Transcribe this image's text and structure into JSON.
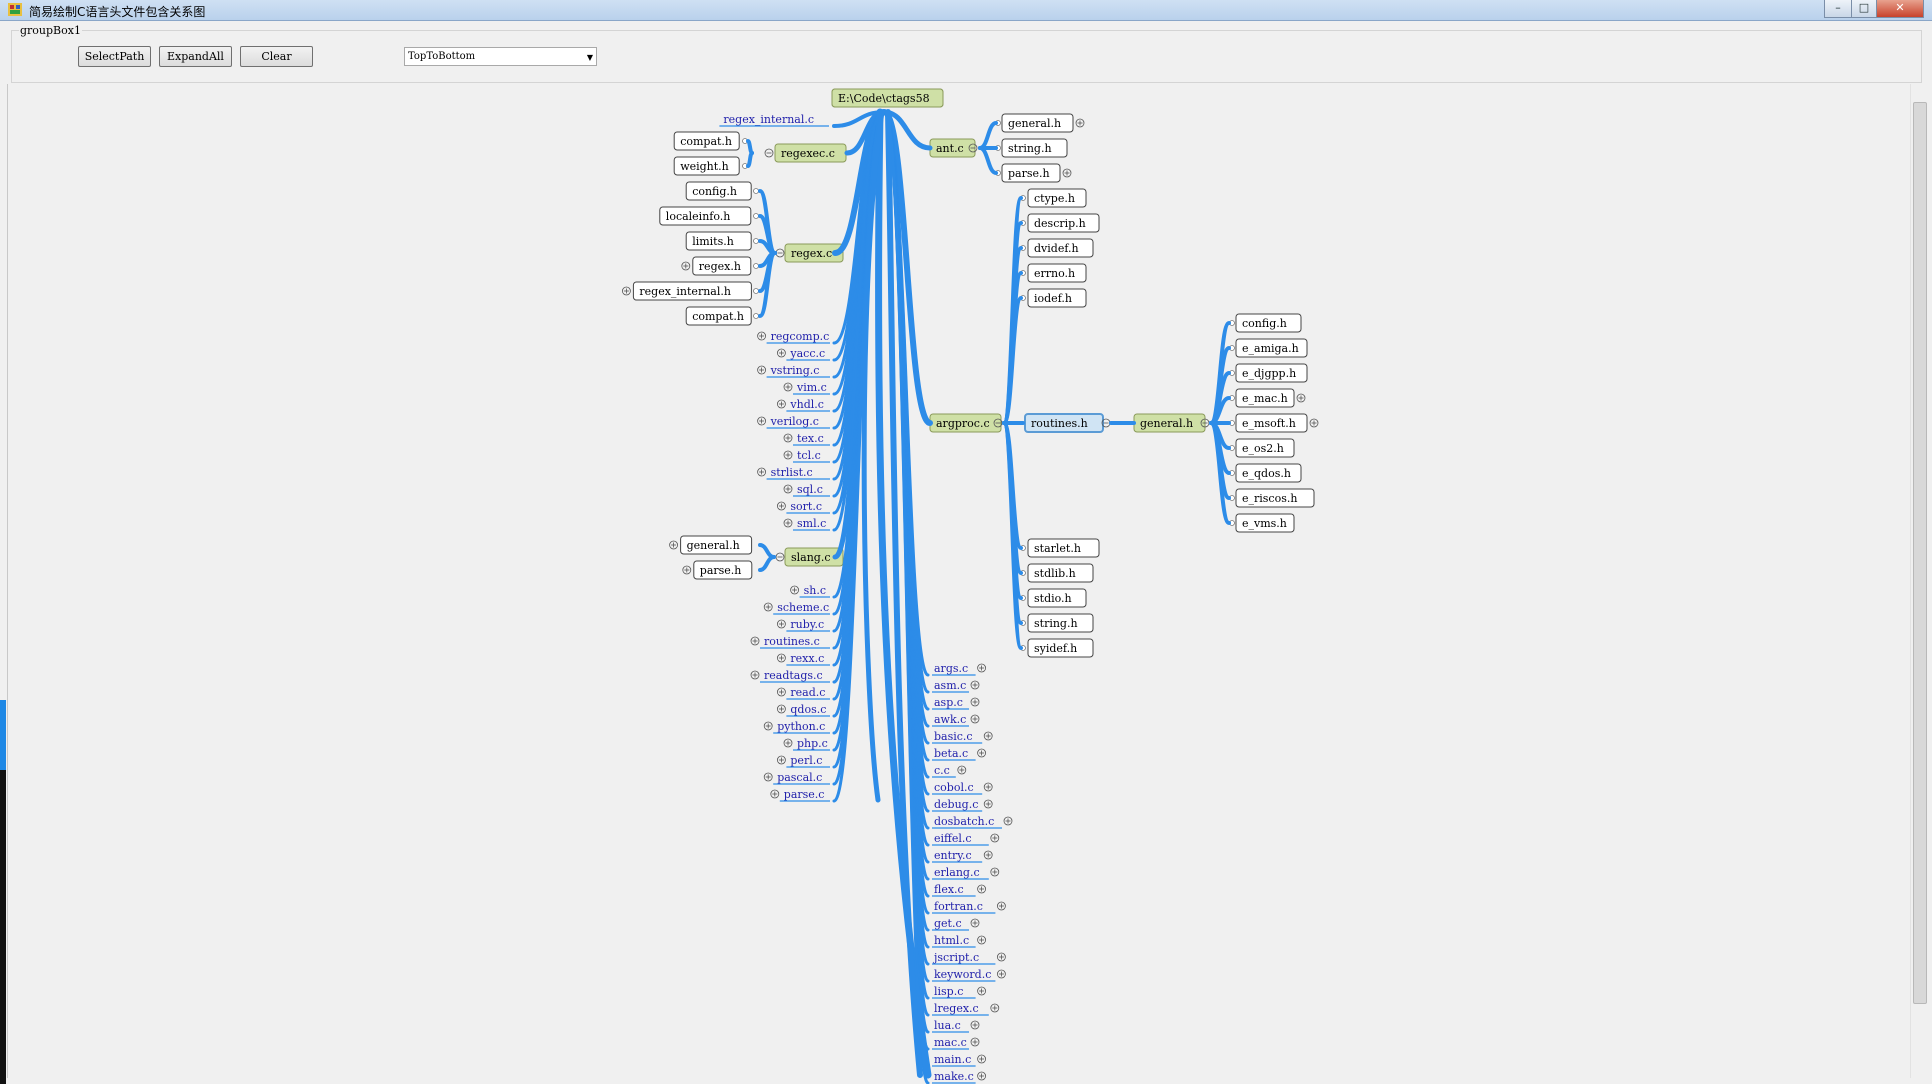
{
  "window": {
    "title": "简易绘制C语言头文件包含关系图",
    "buttons": [
      "–",
      "□",
      "✕"
    ]
  },
  "groupbox": {
    "caption": "groupBox1"
  },
  "toolbar": {
    "select_path": "SelectPath",
    "expand_all": "ExpandAll",
    "clear": "Clear",
    "layout": "TopToBottom"
  },
  "colors": {
    "edge": "#2d8ce8",
    "highlight": "#cfe0a6",
    "selected": "#5b9bd5"
  },
  "tree": {
    "root": "E:\\Code\\ctags58",
    "left_links": [
      "regex_internal.c"
    ],
    "regexec": {
      "name": "regexec.c",
      "children": [
        "compat.h",
        "weight.h"
      ]
    },
    "regex": {
      "name": "regex.c",
      "children": [
        "config.h",
        "localeinfo.h",
        "limits.h",
        "regex.h",
        "regex_internal.h",
        "compat.h"
      ]
    },
    "left_files_a": [
      "regcomp.c",
      "yacc.c",
      "vstring.c",
      "vim.c",
      "vhdl.c",
      "verilog.c",
      "tex.c",
      "tcl.c",
      "strlist.c",
      "sql.c",
      "sort.c",
      "sml.c"
    ],
    "slang": {
      "name": "slang.c",
      "children": [
        "general.h",
        "parse.h"
      ]
    },
    "left_files_b": [
      "sh.c",
      "scheme.c",
      "ruby.c",
      "routines.c",
      "rexx.c",
      "readtags.c",
      "read.c",
      "qdos.c",
      "python.c",
      "php.c",
      "perl.c",
      "pascal.c",
      "parse.c"
    ],
    "ant": {
      "name": "ant.c",
      "children": [
        "general.h",
        "string.h",
        "parse.h"
      ]
    },
    "argproc": {
      "name": "argproc.c",
      "children_top": [
        "ctype.h",
        "descrip.h",
        "dvidef.h",
        "errno.h",
        "iodef.h"
      ],
      "routines": "routines.h",
      "children_bottom": [
        "starlet.h",
        "stdlib.h",
        "stdio.h",
        "string.h",
        "syidef.h"
      ]
    },
    "general": {
      "name": "general.h",
      "children": [
        "config.h",
        "e_amiga.h",
        "e_djgpp.h",
        "e_mac.h",
        "e_msoft.h",
        "e_os2.h",
        "e_qdos.h",
        "e_riscos.h",
        "e_vms.h"
      ]
    },
    "bottom_files": [
      "args.c",
      "asm.c",
      "asp.c",
      "awk.c",
      "basic.c",
      "beta.c",
      "c.c",
      "cobol.c",
      "debug.c",
      "dosbatch.c",
      "eiffel.c",
      "entry.c",
      "erlang.c",
      "flex.c",
      "fortran.c",
      "get.c",
      "html.c",
      "jscript.c",
      "keyword.c",
      "lisp.c",
      "lregex.c",
      "lua.c",
      "mac.c",
      "main.c",
      "make.c"
    ]
  }
}
